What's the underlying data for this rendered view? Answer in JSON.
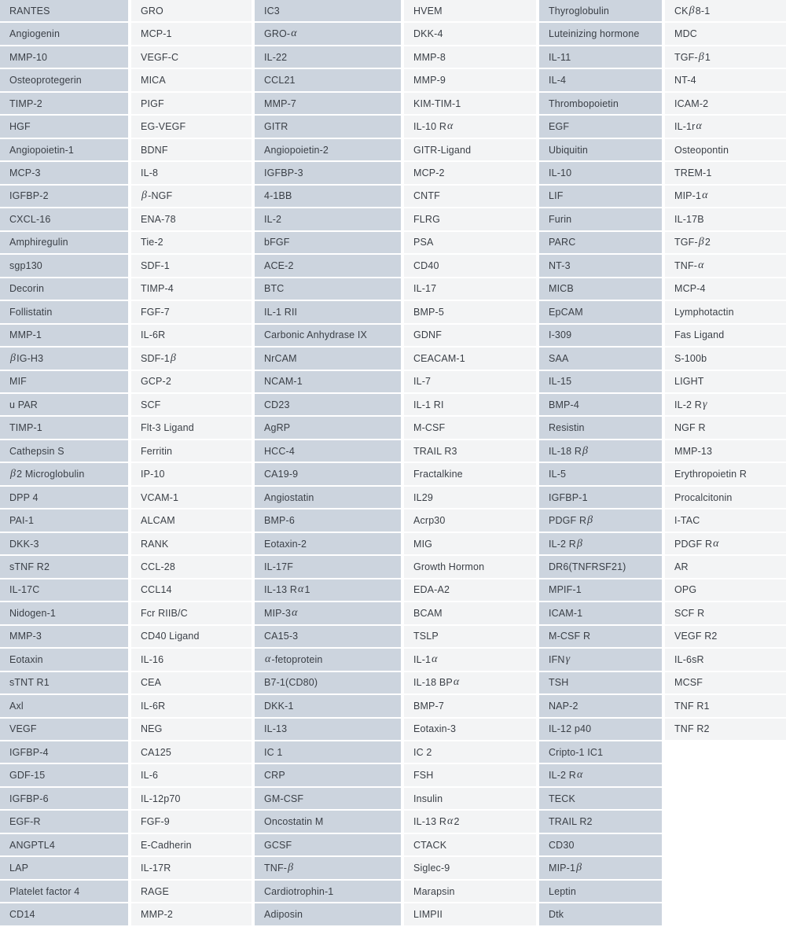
{
  "table": {
    "title": "Protein analyte panel grid",
    "row_count": 40,
    "column_count": 6,
    "colors": {
      "shaded_column_bg": "#ccd4de",
      "plain_column_bg": "#f3f4f5",
      "page_bg": "#ffffff",
      "text": "#3a3f46"
    },
    "columns": [
      {
        "index": 1,
        "style": "shaded",
        "cells": [
          "RANTES",
          "Angiogenin",
          "MMP-10",
          "Osteoprotegerin",
          "TIMP-2",
          "HGF",
          "Angiopoietin-1",
          "MCP-3",
          "IGFBP-2",
          "CXCL-16",
          "Amphiregulin",
          "sgp130",
          "Decorin",
          "Follistatin",
          "MMP-1",
          "β IG-H3",
          "MIF",
          "u PAR",
          "TIMP-1",
          "Cathepsin S",
          "β 2 Microglobulin",
          "DPP 4",
          "PAI-1",
          "DKK-3",
          "sTNF R2",
          "IL-17C",
          "Nidogen-1",
          "MMP-3",
          "Eotaxin",
          "sTNT R1",
          "Axl",
          "VEGF",
          "IGFBP-4",
          "GDF-15",
          "IGFBP-6",
          "EGF-R",
          "ANGPTL4",
          "LAP",
          "Platelet factor 4",
          "CD14"
        ]
      },
      {
        "index": 2,
        "style": "plain",
        "cells": [
          "GRO",
          "MCP-1",
          "VEGF-C",
          "MICA",
          "PIGF",
          "EG-VEGF",
          "BDNF",
          "IL-8",
          "β -NGF",
          "ENA-78",
          "Tie-2",
          "SDF-1",
          "TIMP-4",
          "FGF-7",
          "IL-6R",
          "SDF-1 β",
          "GCP-2",
          "SCF",
          "Flt-3 Ligand",
          "Ferritin",
          "IP-10",
          "VCAM-1",
          "ALCAM",
          "RANK",
          "CCL-28",
          "CCL14",
          "Fcr RIIB/C",
          "CD40 Ligand",
          "IL-16",
          "CEA",
          "IL-6R",
          "NEG",
          "CA125",
          "IL-6",
          "IL-12p70",
          "FGF-9",
          "E-Cadherin",
          "IL-17R",
          "RAGE",
          "MMP-2"
        ]
      },
      {
        "index": 3,
        "style": "shaded",
        "cells": [
          "IC3",
          "GRO- α",
          "IL-22",
          "CCL21",
          "MMP-7",
          "GITR",
          "Angiopoietin-2",
          "IGFBP-3",
          "4-1BB",
          "IL-2",
          "bFGF",
          "ACE-2",
          "BTC",
          "IL-1 RII",
          "Carbonic Anhydrase IX",
          "NrCAM",
          "NCAM-1",
          "CD23",
          "AgRP",
          "HCC-4",
          "CA19-9",
          "Angiostatin",
          "BMP-6",
          "Eotaxin-2",
          "IL-17F",
          "IL-13 R α 1",
          "MIP-3 α",
          "CA15-3",
          "α -fetoprotein",
          "B7-1(CD80)",
          "DKK-1",
          "IL-13",
          "IC 1",
          "CRP",
          "GM-CSF",
          "Oncostatin M",
          "GCSF",
          "TNF- β",
          "Cardiotrophin-1",
          "Adiposin"
        ]
      },
      {
        "index": 4,
        "style": "plain",
        "cells": [
          "HVEM",
          "DKK-4",
          "MMP-8",
          "MMP-9",
          "KIM-TIM-1",
          "IL-10 R α",
          "GITR-Ligand",
          "MCP-2",
          "CNTF",
          "FLRG",
          "PSA",
          "CD40",
          "IL-17",
          "BMP-5",
          "GDNF",
          "CEACAM-1",
          "IL-7",
          "IL-1 RI",
          "M-CSF",
          "TRAIL R3",
          "Fractalkine",
          "IL29",
          "Acrp30",
          "MIG",
          "Growth Hormon",
          "EDA-A2",
          "BCAM",
          "TSLP",
          "IL-1 α",
          "IL-18 BP α",
          "BMP-7",
          "Eotaxin-3",
          "IC 2",
          "FSH",
          "Insulin",
          "IL-13 R α 2",
          "CTACK",
          "Siglec-9",
          "Marapsin",
          "LIMPII"
        ]
      },
      {
        "index": 5,
        "style": "shaded",
        "cells": [
          "Thyroglobulin",
          "Luteinizing hormone",
          "IL-11",
          "IL-4",
          "Thrombopoietin",
          "EGF",
          "Ubiquitin",
          "IL-10",
          "LIF",
          "Furin",
          "PARC",
          "NT-3",
          "MICB",
          "EpCAM",
          "I-309",
          "SAA",
          "IL-15",
          "BMP-4",
          "Resistin",
          "IL-18 R β",
          "IL-5",
          "IGFBP-1",
          "PDGF R β",
          "IL-2 R β",
          "DR6(TNFRSF21)",
          "MPIF-1",
          "ICAM-1",
          "M-CSF R",
          "IFN γ",
          "TSH",
          "NAP-2",
          "IL-12 p40",
          "Cripto-1 IC1",
          "IL-2 R α",
          "TECK",
          "TRAIL R2",
          "CD30",
          "MIP-1 β",
          "Leptin",
          "Dtk"
        ]
      },
      {
        "index": 6,
        "style": "plain",
        "cells": [
          "CK β 8-1",
          "MDC",
          "TGF- β 1",
          "NT-4",
          "ICAM-2",
          "IL-1r α",
          "Osteopontin",
          "TREM-1",
          "MIP-1 α",
          "IL-17B",
          "TGF- β 2",
          "TNF- α",
          "MCP-4",
          "Lymphotactin",
          "Fas Ligand",
          "S-100b",
          "LIGHT",
          "IL-2 R γ",
          "NGF R",
          "MMP-13",
          "Erythropoietin R",
          "Procalcitonin",
          "I-TAC",
          "PDGF R α",
          "AR",
          "OPG",
          "SCF R",
          "VEGF R2",
          "IL-6sR",
          "MCSF",
          "TNF R1",
          "TNF R2",
          "",
          "",
          "",
          "",
          "",
          "",
          "",
          ""
        ]
      }
    ]
  }
}
